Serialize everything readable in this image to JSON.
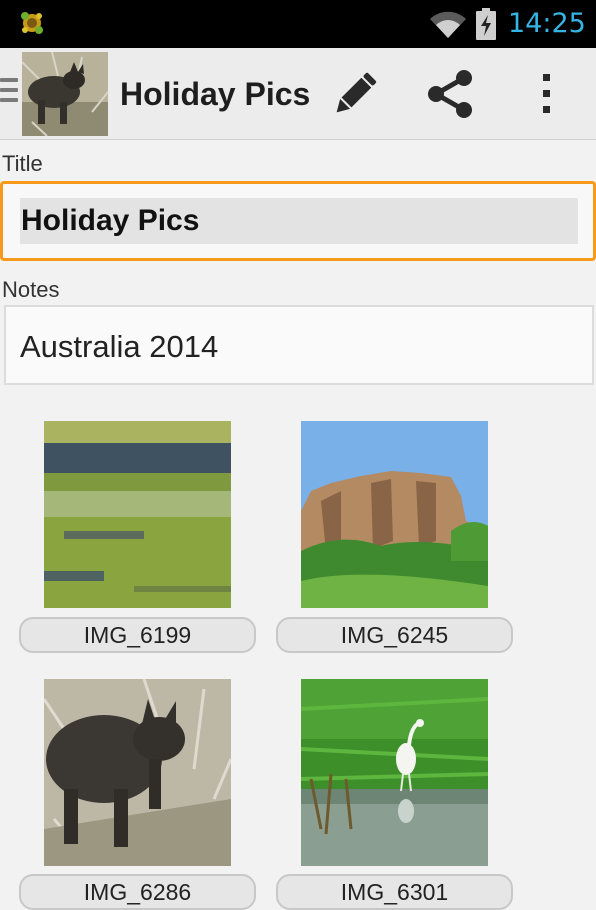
{
  "status_bar": {
    "time": "14:25",
    "icons": [
      "app-notification-icon",
      "wifi-icon",
      "battery-charging-icon"
    ],
    "time_color": "#33b5e5"
  },
  "action_bar": {
    "title": "Holiday Pics",
    "actions": [
      "edit-icon",
      "share-icon",
      "overflow-menu-icon"
    ]
  },
  "form": {
    "title_label": "Title",
    "title_value": "Holiday Pics",
    "notes_label": "Notes",
    "notes_value": "Australia 2014",
    "focus_color": "#f79a1c"
  },
  "photos": [
    {
      "caption": "IMG_6199",
      "subject": "wetland"
    },
    {
      "caption": "IMG_6245",
      "subject": "rock-escarpment"
    },
    {
      "caption": "IMG_6286",
      "subject": "wallaby"
    },
    {
      "caption": "IMG_6301",
      "subject": "egret"
    }
  ]
}
